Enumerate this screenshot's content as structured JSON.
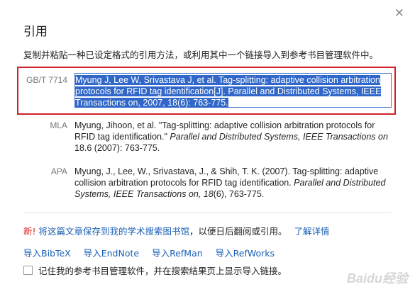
{
  "dialog": {
    "title": "引用",
    "close_glyph": "×",
    "intro": "复制并粘贴一种已设定格式的引用方法，或利用其中一个链接导入到参考书目管理软件中。"
  },
  "citations": {
    "gb": {
      "label": "GB/T 7714",
      "text": "Myung J, Lee W, Srivastava J, et al. Tag-splitting: adaptive collision arbitration protocols for RFID tag identification[J]. Parallel and Distributed Systems, IEEE Transactions on, 2007, 18(6): 763-775."
    },
    "mla": {
      "label": "MLA",
      "plain1": "Myung, Jihoon, et al. \"Tag-splitting: adaptive collision arbitration protocols for RFID tag identification.\" ",
      "italic1": "Parallel and Distributed Systems, IEEE Transactions on",
      "plain2": " 18.6 (2007): 763-775."
    },
    "apa": {
      "label": "APA",
      "plain1": "Myung, J., Lee, W., Srivastava, J., & Shih, T. K. (2007). Tag-splitting: adaptive collision arbitration protocols for RFID tag identification. ",
      "italic1": "Parallel and Distributed Systems, IEEE Transactions on, 18",
      "plain2": "(6), 763-775."
    }
  },
  "promo": {
    "new_label": "新!",
    "save_link": "将这篇文章保存到我的学术搜索图书馆",
    "text": "，以便日后翻阅或引用。",
    "learn_more": "了解详情"
  },
  "exports": {
    "bibtex": "导入BibTeX",
    "endnote": "导入EndNote",
    "refman": "导入RefMan",
    "refworks": "导入RefWorks"
  },
  "remember": {
    "label": "记住我的参考书目管理软件，并在搜索结果页上显示导入链接。",
    "checked": false
  },
  "watermark": "Baidu经验",
  "colors": {
    "highlight_border": "#d01f26",
    "selection": "#3067c9",
    "link": "#1a5fb4",
    "new_red": "#dd2222"
  }
}
